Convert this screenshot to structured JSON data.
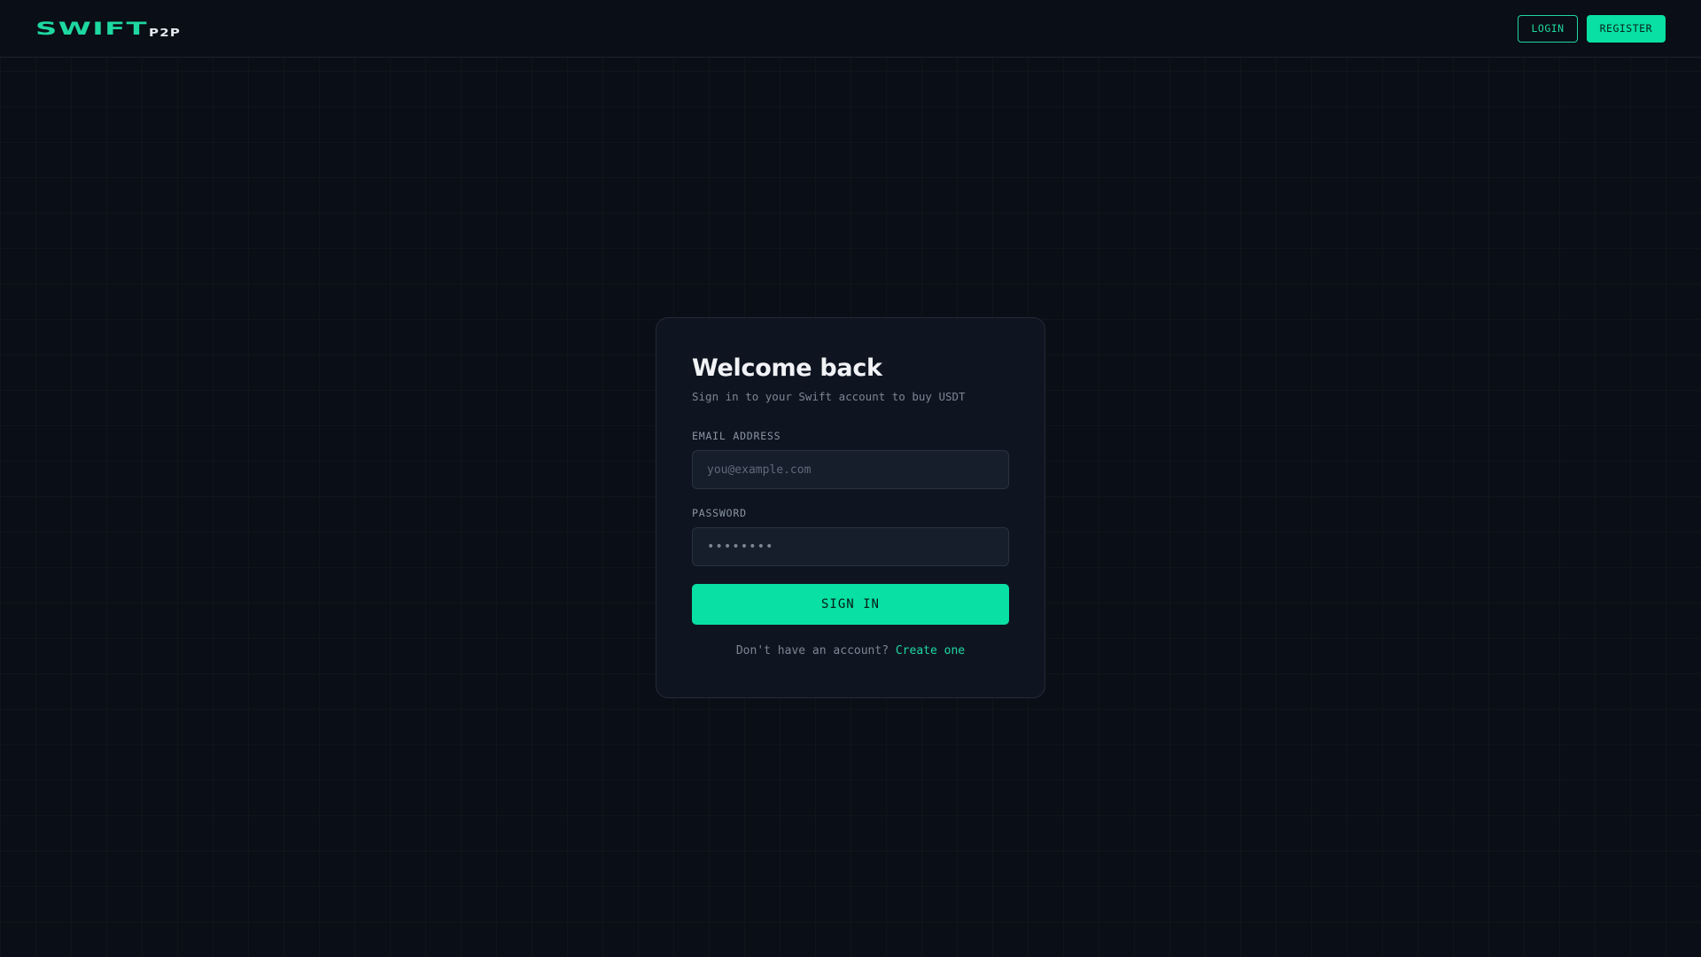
{
  "header": {
    "logo_main": "SWIFT",
    "logo_sub": "P2P",
    "login_label": "LOGIN",
    "register_label": "REGISTER"
  },
  "login_card": {
    "title": "Welcome back",
    "subtitle": "Sign in to your Swift account to buy USDT",
    "email_label": "EMAIL ADDRESS",
    "email_placeholder": "you@example.com",
    "password_label": "PASSWORD",
    "password_placeholder": "••••••••",
    "submit_label": "SIGN IN",
    "footer_text": "Don't have an account?",
    "footer_link": "Create one"
  },
  "colors": {
    "accent": "#08e0a4",
    "background": "#0a0e16",
    "card": "#0f1520"
  }
}
